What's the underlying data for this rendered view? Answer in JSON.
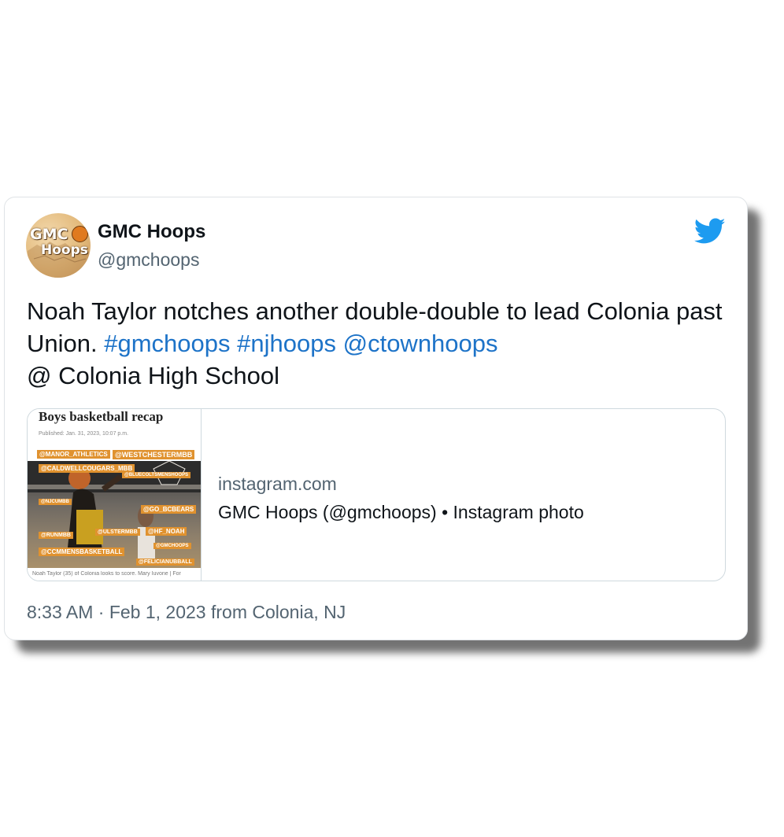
{
  "tweet": {
    "author_name": "GMC Hoops",
    "author_handle": "@gmchoops",
    "avatar_text_line1": "GMC",
    "avatar_text_line2": "Hoops",
    "text_part1": "Noah Taylor notches another double-double to lead Colonia past Union.  ",
    "hashtag1": "#gmchoops",
    "hashtag2": "#njhoops",
    "mention": "@ctownhoops",
    "text_part2": "@ Colonia High School",
    "timestamp": "8:33 AM · Feb 1, 2023 from Colonia, NJ"
  },
  "embed": {
    "domain": "instagram.com",
    "title": "GMC Hoops (@gmchoops) • Instagram photo",
    "thumbnail": {
      "title": "Boys basketball recap",
      "published": "Published: Jan. 31, 2023, 10:07 p.m.",
      "tags": [
        "@MANOR_ATHLETICS",
        "@WESTCHESTERMBB",
        "@CALDWELLCOUGARS_MBB",
        "@BLUECOLTSMENSHOOPS",
        "@NJCUMBB",
        "@GO_BCBEARS",
        "@ULSTERMBB",
        "@HF_NOAH",
        "@RUNMBB",
        "@GMCHOOPS",
        "@CCMMENSBASKETBALL",
        "@FELICIANUBBALL"
      ],
      "caption": "Noah Taylor (35) of Colonia looks to score.  Mary Iuvone | For"
    }
  },
  "colors": {
    "link": "#1d73c8",
    "twitter_blue": "#1d9bf0",
    "secondary_text": "#536471",
    "tag_orange": "#e0922f"
  },
  "icons": {
    "brand": "twitter-bird-icon"
  }
}
